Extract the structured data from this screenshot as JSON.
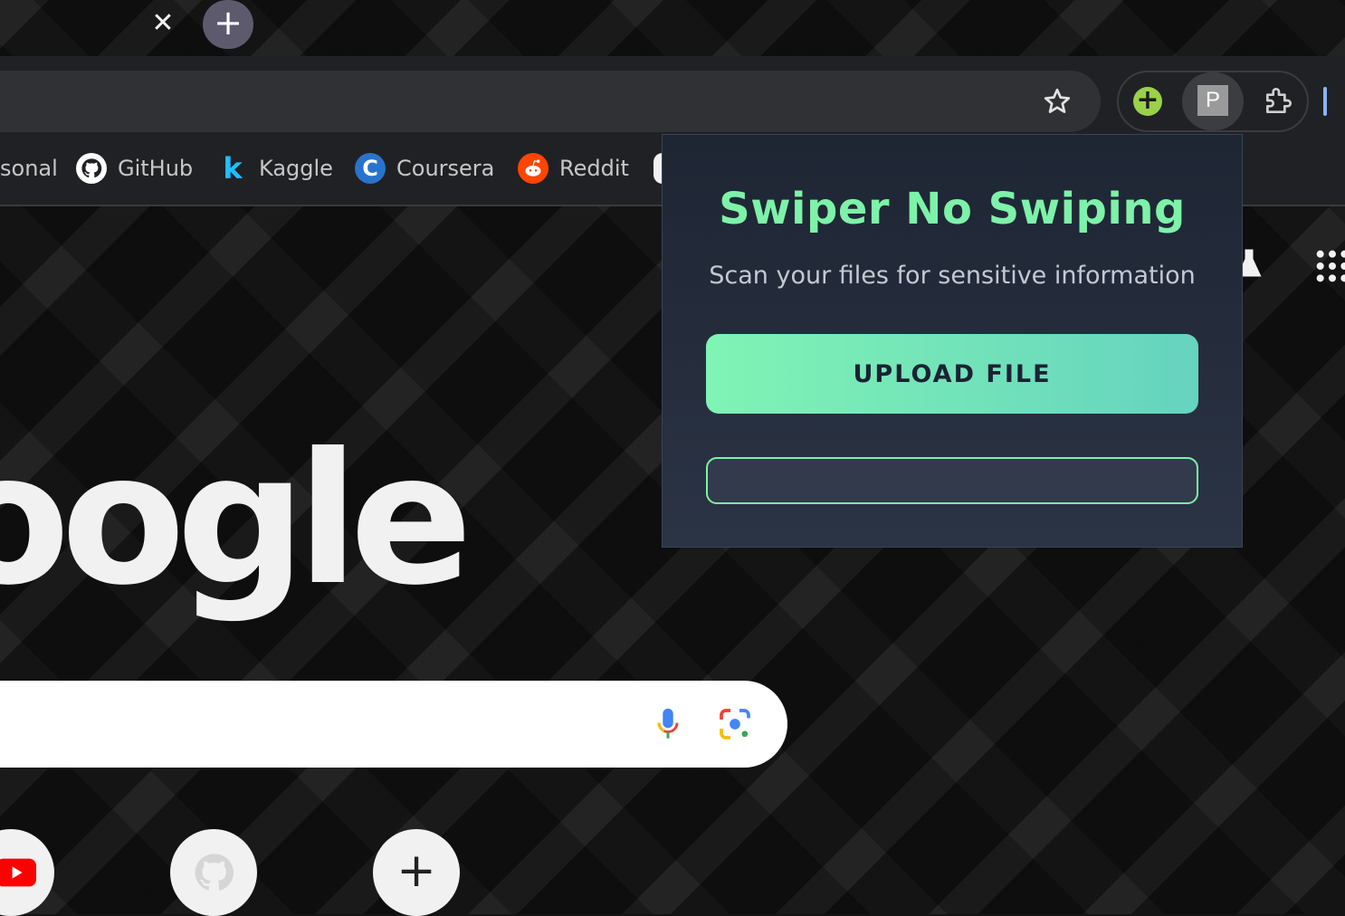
{
  "tabstrip": {
    "close_glyph": "✕",
    "new_tab_glyph": "+"
  },
  "toolbar": {
    "star_icon": "star-icon",
    "extensions": [
      {
        "name": "ext-plus-icon",
        "glyph": "+"
      },
      {
        "name": "ext-p-icon",
        "glyph": "P"
      },
      {
        "name": "puzzle-icon"
      }
    ]
  },
  "bookmarks": {
    "items": [
      {
        "label": "sonal"
      },
      {
        "label": "GitHub",
        "icon": "github-icon"
      },
      {
        "label": "Kaggle",
        "icon": "kaggle-icon",
        "glyph": "k"
      },
      {
        "label": "Coursera",
        "icon": "coursera-icon",
        "glyph": "C"
      },
      {
        "label": "Reddit",
        "icon": "reddit-icon"
      }
    ]
  },
  "newtab": {
    "logo_text": "oogle",
    "shortcut_add_glyph": "+"
  },
  "popup": {
    "title": "Swiper No Swiping",
    "subtitle": "Scan your files for sensitive information",
    "upload_label": "UPLOAD FILE",
    "result_value": ""
  },
  "colors": {
    "accent": "#7df2a8",
    "popup_bg": "#1e2533",
    "button_gradient_start": "#7ff4b4",
    "button_gradient_end": "#65d3bf"
  }
}
